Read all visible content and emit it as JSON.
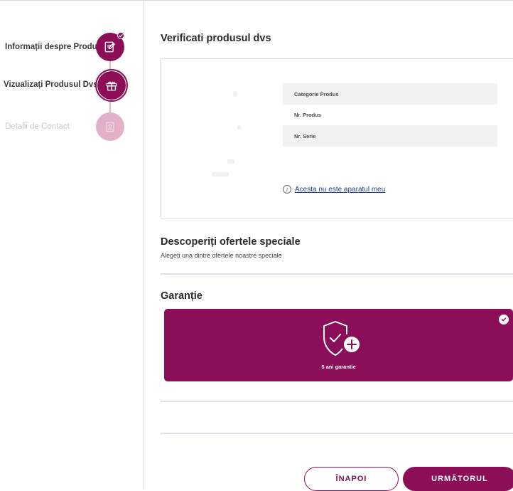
{
  "stepper": {
    "steps": [
      {
        "label": "Informații despre Produs",
        "state": "done",
        "icon": "edit-form-icon"
      },
      {
        "label": "Vizualizați Produsul Dvs.",
        "state": "active",
        "icon": "gift-icon"
      },
      {
        "label": "Detalii de Contact",
        "state": "disabled",
        "icon": "contact-icon"
      }
    ]
  },
  "main": {
    "verify_title": "Verificati produsul dvs",
    "product_info": {
      "rows": [
        {
          "label": "Categorie Produs"
        },
        {
          "label": "Nr. Produs"
        },
        {
          "label": "Nr. Serie"
        }
      ],
      "not_mine_label": "Acesta nu este aparatul meu"
    },
    "offers": {
      "title": "Descoperiți ofertele speciale",
      "subtitle": "Alegeți una dintre ofertele noastre speciale"
    },
    "warranty": {
      "title": "Garanție",
      "option_label": "5 ani garantie",
      "selected": true
    }
  },
  "buttons": {
    "back_label": "ÎNAPOI",
    "next_label": "URMĂTORUL"
  },
  "colors": {
    "accent": "#8c0e57",
    "accent_light": "#e3b0c9"
  }
}
